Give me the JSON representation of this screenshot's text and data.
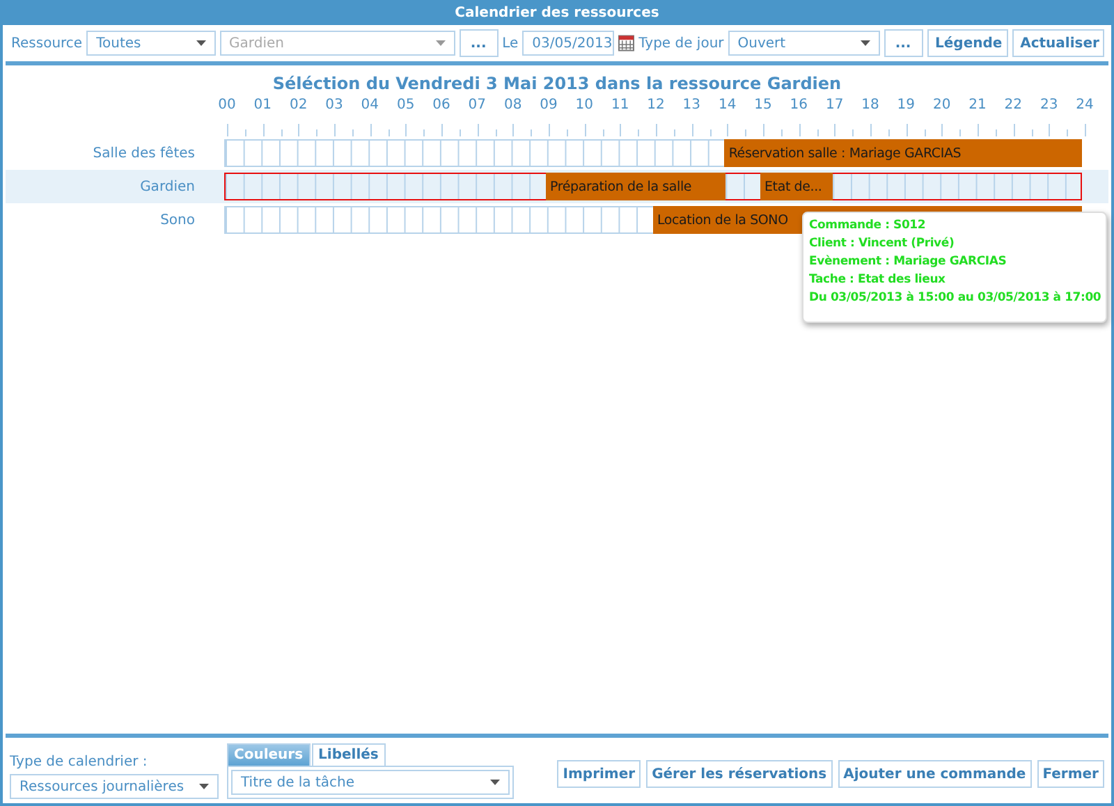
{
  "window": {
    "title": "Calendrier des ressources"
  },
  "toolbar": {
    "resource_label": "Ressource",
    "resource_filter": "Toutes",
    "resource": {
      "value": "Gardien",
      "disabled": true
    },
    "resource_more": "...",
    "date_label": "Le",
    "date": "03/05/2013",
    "day_type_label": "Type de jour",
    "day_type": "Ouvert",
    "day_type_more": "...",
    "buttons": [
      "Légende",
      "Actualiser"
    ]
  },
  "heading": "Séléction du Vendredi 3 Mai 2013 dans la ressource Gardien",
  "hours": [
    "00",
    "01",
    "02",
    "03",
    "04",
    "05",
    "06",
    "07",
    "08",
    "09",
    "10",
    "11",
    "12",
    "13",
    "14",
    "15",
    "16",
    "17",
    "18",
    "19",
    "20",
    "21",
    "22",
    "23",
    "24"
  ],
  "rows": [
    {
      "name": "Salle des fêtes",
      "selected": false,
      "slots": [
        {
          "kind": "free"
        },
        {
          "kind": "free"
        },
        {
          "kind": "free"
        },
        {
          "kind": "free"
        },
        {
          "kind": "free"
        },
        {
          "kind": "free"
        },
        {
          "kind": "free"
        },
        {
          "kind": "free"
        },
        {
          "kind": "free"
        },
        {
          "kind": "free"
        },
        {
          "kind": "free"
        },
        {
          "kind": "free"
        },
        {
          "kind": "free"
        },
        {
          "kind": "free"
        },
        {
          "kind": "start",
          "label": "Réservation salle : Mariage GARCIAS"
        },
        {
          "kind": "busy"
        },
        {
          "kind": "busy"
        },
        {
          "kind": "busy"
        },
        {
          "kind": "busy"
        },
        {
          "kind": "busy"
        },
        {
          "kind": "busy"
        },
        {
          "kind": "busy"
        },
        {
          "kind": "busy"
        },
        {
          "kind": "busy"
        }
      ]
    },
    {
      "name": "Gardien",
      "selected": true,
      "slots": [
        {
          "kind": "free"
        },
        {
          "kind": "free"
        },
        {
          "kind": "free"
        },
        {
          "kind": "free"
        },
        {
          "kind": "free"
        },
        {
          "kind": "free"
        },
        {
          "kind": "free"
        },
        {
          "kind": "free"
        },
        {
          "kind": "free"
        },
        {
          "kind": "start",
          "label": "Préparation de la salle"
        },
        {
          "kind": "busy"
        },
        {
          "kind": "busy"
        },
        {
          "kind": "busy"
        },
        {
          "kind": "busy"
        },
        {
          "kind": "free"
        },
        {
          "kind": "start",
          "label": "Etat de..."
        },
        {
          "kind": "busy"
        },
        {
          "kind": "free"
        },
        {
          "kind": "free"
        },
        {
          "kind": "free"
        },
        {
          "kind": "free"
        },
        {
          "kind": "free"
        },
        {
          "kind": "free"
        },
        {
          "kind": "free"
        }
      ]
    },
    {
      "name": "Sono",
      "selected": false,
      "slots": [
        {
          "kind": "free"
        },
        {
          "kind": "free"
        },
        {
          "kind": "free"
        },
        {
          "kind": "free"
        },
        {
          "kind": "free"
        },
        {
          "kind": "free"
        },
        {
          "kind": "free"
        },
        {
          "kind": "free"
        },
        {
          "kind": "free"
        },
        {
          "kind": "free"
        },
        {
          "kind": "free"
        },
        {
          "kind": "free"
        },
        {
          "kind": "start",
          "label": "Location de la SONO"
        },
        {
          "kind": "busy"
        },
        {
          "kind": "busy"
        },
        {
          "kind": "busy"
        },
        {
          "kind": "busy"
        },
        {
          "kind": "busy"
        },
        {
          "kind": "busy"
        },
        {
          "kind": "busy"
        },
        {
          "kind": "busy"
        },
        {
          "kind": "busy"
        },
        {
          "kind": "busy"
        },
        {
          "kind": "busy"
        }
      ]
    }
  ],
  "tooltip": [
    "Commande : S012",
    "Client : Vincent (Privé)",
    "Evènement : Mariage GARCIAS",
    "Tache : Etat des lieux",
    "Du 03/05/2013 à 15:00 au 03/05/2013 à 17:00"
  ],
  "footer": {
    "calendar_type_label": "Type de calendrier :",
    "calendar_type": "Ressources journalières",
    "tabs": [
      {
        "label": "Couleurs",
        "selected": true
      },
      {
        "label": "Libellés",
        "selected": false
      }
    ],
    "label_field": "Titre de la tâche",
    "buttons": [
      "Imprimer",
      "Gérer les réservations",
      "Ajouter une commande",
      "Fermer"
    ]
  }
}
